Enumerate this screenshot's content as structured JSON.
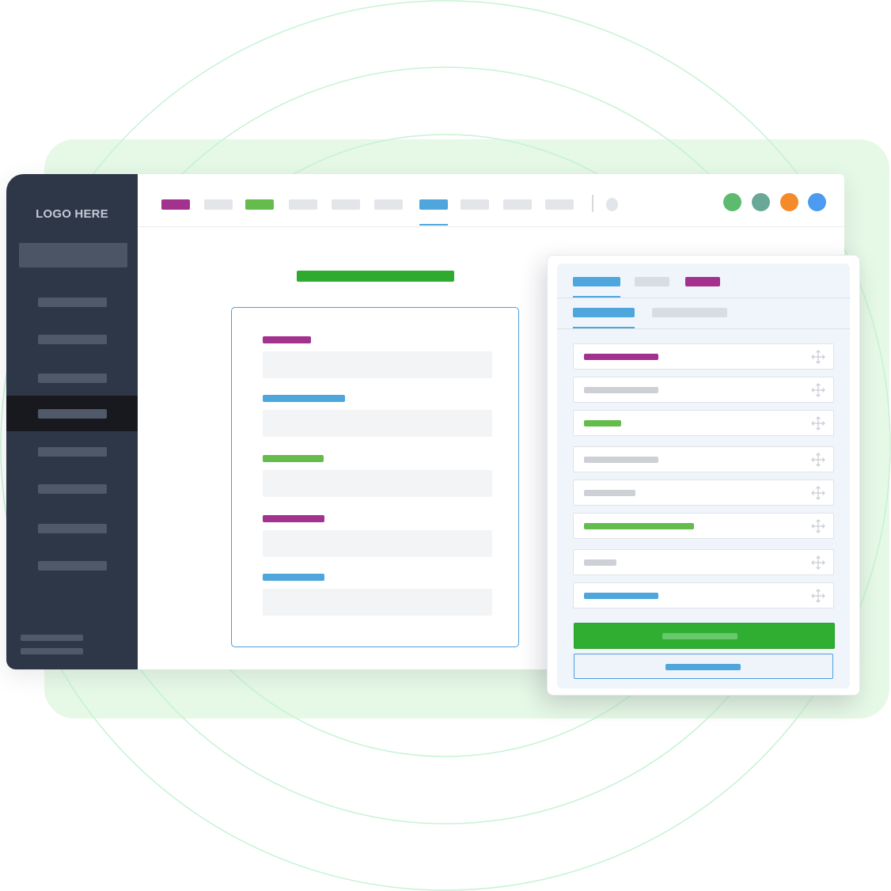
{
  "colors": {
    "purple": "#a3318e",
    "green": "#63bc4b",
    "blue": "#4ea6dd",
    "gray": "#e3e5e8",
    "dark_green": "#2eab2e",
    "sidebar_bg": "#2e3748",
    "sidebar_active": "#17191e"
  },
  "sidebar": {
    "logo": "LOGO HERE",
    "items": [
      "item",
      "item",
      "item",
      "item",
      "item",
      "item",
      "item",
      "item"
    ],
    "active_index": 3
  },
  "topnav": {
    "tabs": [
      {
        "color": "#a3318e"
      },
      {
        "color": "#e3e5e8"
      },
      {
        "color": "#63bc4b"
      },
      {
        "color": "#e3e5e8"
      },
      {
        "color": "#e3e5e8"
      },
      {
        "color": "#e3e5e8"
      },
      {
        "color": "#4ea6dd",
        "active": true
      },
      {
        "color": "#e3e5e8"
      },
      {
        "color": "#e3e5e8"
      },
      {
        "color": "#e3e5e8"
      }
    ],
    "action_buttons": [
      "#5dbb6f",
      "#69a896",
      "#f58a2a",
      "#4c9bf0"
    ]
  },
  "form": {
    "fields": [
      {
        "label_color": "#a3318e"
      },
      {
        "label_color": "#4ea6dd"
      },
      {
        "label_color": "#63bc4b"
      },
      {
        "label_color": "#a3318e"
      },
      {
        "label_color": "#4ea6dd"
      }
    ]
  },
  "panel": {
    "tabs": [
      {
        "color": "#4ea6dd",
        "active": true
      },
      {
        "color": "#d8dde3"
      },
      {
        "color": "#a3318e"
      }
    ],
    "subtabs": [
      {
        "color": "#4ea6dd",
        "active": true
      },
      {
        "color": "#d8dde3"
      }
    ],
    "rows": [
      {
        "color": "#a3318e",
        "icon": "move-icon"
      },
      {
        "color": "#cdd1d6",
        "icon": "move-icon"
      },
      {
        "color": "#63bc4b",
        "icon": "move-icon"
      },
      {
        "color": "#cdd1d6",
        "icon": "move-icon"
      },
      {
        "color": "#cdd1d6",
        "icon": "move-icon"
      },
      {
        "color": "#63bc4b",
        "icon": "move-icon"
      },
      {
        "color": "#cdd1d6",
        "icon": "move-icon"
      },
      {
        "color": "#4ea6dd",
        "icon": "move-icon"
      }
    ],
    "primary_button_color": "#2fae32",
    "secondary_button_color": "#4ea6dd"
  }
}
